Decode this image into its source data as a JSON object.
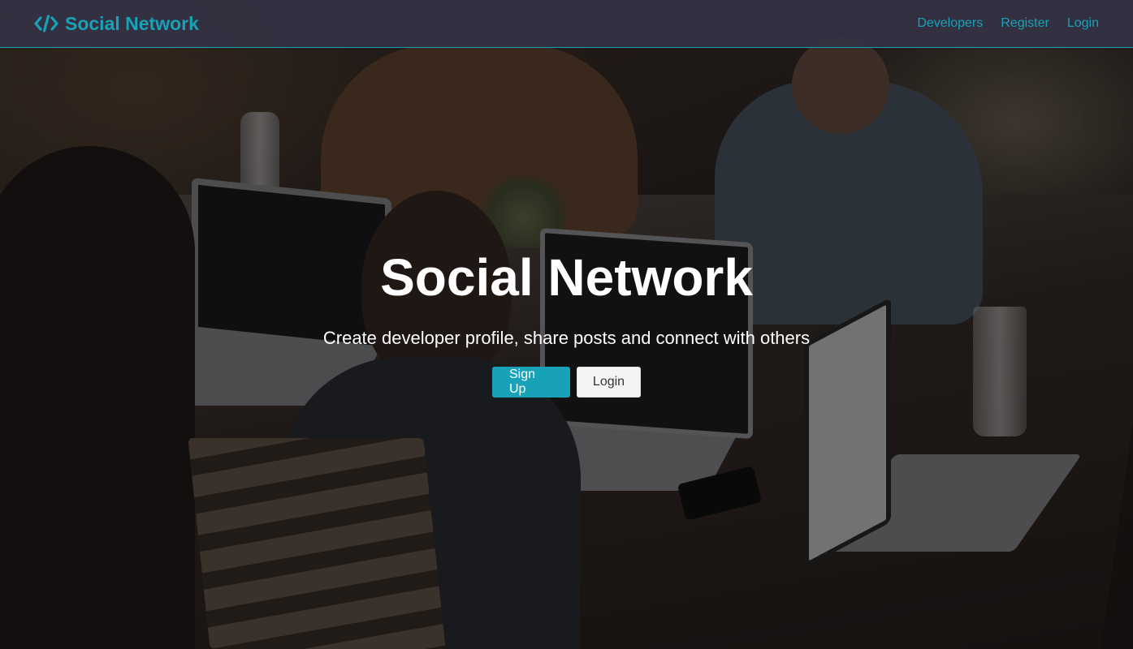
{
  "colors": {
    "accent": "#17a2b8",
    "navbar_background": "#343144",
    "hero_text": "#ffffff",
    "light_button": "#f4f4f4"
  },
  "navbar": {
    "brand_icon": "code-icon",
    "brand_label": "Social Network",
    "links": [
      {
        "label": "Developers"
      },
      {
        "label": "Register"
      },
      {
        "label": "Login"
      }
    ]
  },
  "hero": {
    "title": "Social Network",
    "lead": "Create developer profile, share posts and connect with others",
    "signup_label": "Sign Up",
    "login_label": "Login"
  }
}
